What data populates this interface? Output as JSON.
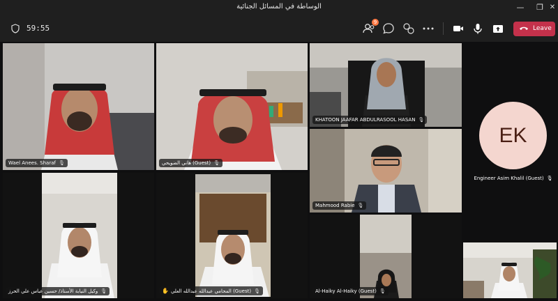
{
  "window": {
    "title": "الوساطة في المسائل الجنائية",
    "minimize": "—",
    "restore": "❐",
    "close": "✕"
  },
  "toolbar": {
    "timer": "59:55",
    "participants_badge": "9",
    "leave_label": "Leave",
    "accent": "#c4314b"
  },
  "participants": [
    {
      "name": "Wael Anees. Sharaf"
    },
    {
      "name": "هاني الضويحي (Guest)"
    },
    {
      "name": "KHATOON JAAFAR ABDULRASOOL HASAN"
    },
    {
      "name": "Mahmood Rabie"
    },
    {
      "name": "وكيل النيابة الأستاذ/ حسين عباس علي الحرز"
    },
    {
      "name": "المحامي عبدالله عبدالله العلي (Guest)"
    },
    {
      "name": "Al-Haiky Al-Haiky (Guest)"
    }
  ],
  "avatar": {
    "initials": "EK",
    "name": "Engineer Asim Khalil (Guest)"
  }
}
